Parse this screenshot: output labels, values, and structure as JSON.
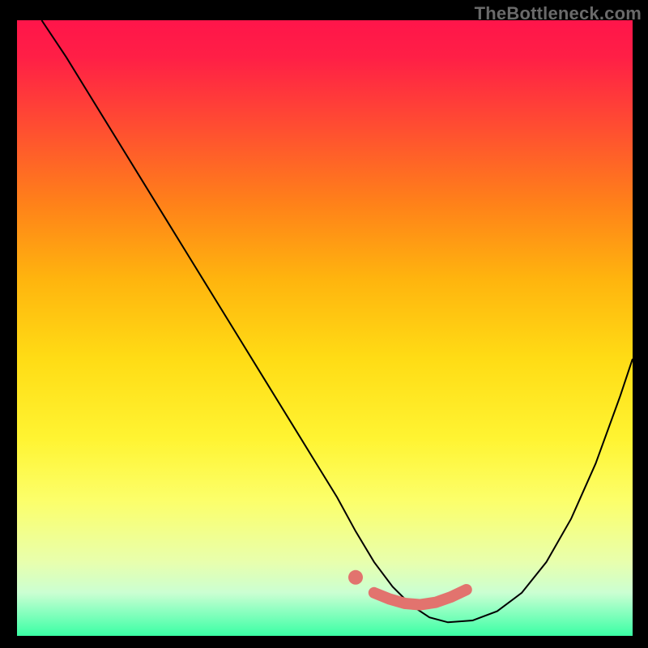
{
  "watermark": "TheBottleneck.com",
  "chart_data": {
    "type": "line",
    "title": "",
    "xlabel": "",
    "ylabel": "",
    "xlim": [
      0,
      100
    ],
    "ylim": [
      0,
      100
    ],
    "series": [
      {
        "name": "curve",
        "x": [
          4,
          8,
          12,
          16,
          20,
          24,
          28,
          32,
          36,
          40,
          44,
          48,
          52,
          55,
          58,
          61,
          64,
          67,
          70,
          74,
          78,
          82,
          86,
          90,
          94,
          98,
          100
        ],
        "values": [
          100,
          94,
          87.5,
          81,
          74.5,
          68,
          61.5,
          55,
          48.5,
          42,
          35.5,
          29,
          22.5,
          17,
          12,
          8,
          5,
          3,
          2.2,
          2.5,
          4,
          7,
          12,
          19,
          28,
          39,
          45
        ]
      }
    ],
    "highlight": {
      "dot": {
        "x": 55,
        "y": 9.5
      },
      "segment": {
        "x": [
          58,
          73
        ],
        "y": [
          7,
          7.5
        ]
      }
    }
  }
}
